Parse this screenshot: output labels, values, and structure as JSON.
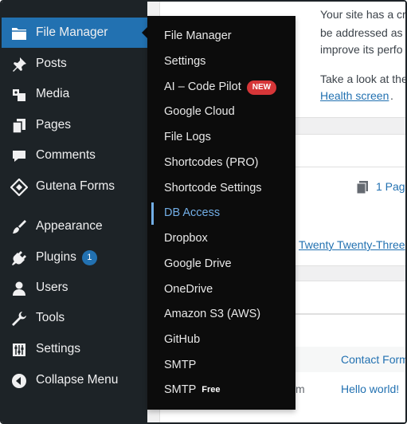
{
  "sidebar": {
    "items": [
      {
        "label": "File Manager",
        "icon": "file-manager-icon",
        "active": true
      },
      {
        "label": "Posts",
        "icon": "pin-icon"
      },
      {
        "label": "Media",
        "icon": "media-icon"
      },
      {
        "label": "Pages",
        "icon": "pages-icon"
      },
      {
        "label": "Comments",
        "icon": "comments-icon"
      },
      {
        "label": "Gutena Forms",
        "icon": "gutena-forms-icon"
      },
      {
        "label": "Appearance",
        "icon": "appearance-brush-icon"
      },
      {
        "label": "Plugins",
        "icon": "plugins-icon",
        "badge": "1"
      },
      {
        "label": "Users",
        "icon": "users-icon"
      },
      {
        "label": "Tools",
        "icon": "tools-wrench-icon"
      },
      {
        "label": "Settings",
        "icon": "settings-sliders-icon"
      },
      {
        "label": "Collapse Menu",
        "icon": "collapse-arrow-icon"
      }
    ]
  },
  "flyout": {
    "items": [
      {
        "label": "File Manager"
      },
      {
        "label": "Settings"
      },
      {
        "label": "AI – Code Pilot",
        "badge": "NEW"
      },
      {
        "label": "Google Cloud"
      },
      {
        "label": "File Logs"
      },
      {
        "label": "Shortcodes (PRO)"
      },
      {
        "label": "Shortcode Settings"
      },
      {
        "label": "DB Access",
        "current": true
      },
      {
        "label": "Dropbox"
      },
      {
        "label": "Google Drive"
      },
      {
        "label": "OneDrive"
      },
      {
        "label": "Amazon S3 (AWS)"
      },
      {
        "label": "GitHub"
      },
      {
        "label": "SMTP"
      },
      {
        "label": "SMTP",
        "tag": "Free"
      }
    ]
  },
  "content": {
    "notice_line1": "Your site has a cr",
    "notice_line2": "be addressed as",
    "notice_line3": "improve its perfo",
    "notice_line4": "Take a look at the",
    "health_link": "Health screen",
    "health_suffix": ".",
    "pages_count": "1 Pag",
    "theme_link": "Twenty Twenty-Three",
    "contact_link": "Contact Form",
    "hello_link": "Hello world!",
    "partial_m": "m"
  },
  "colors": {
    "sidebar_bg": "#1d2327",
    "flyout_bg": "#0c0c0c",
    "active_bg": "#2271b1",
    "current_accent": "#72aee6",
    "new_badge": "#d63638"
  }
}
